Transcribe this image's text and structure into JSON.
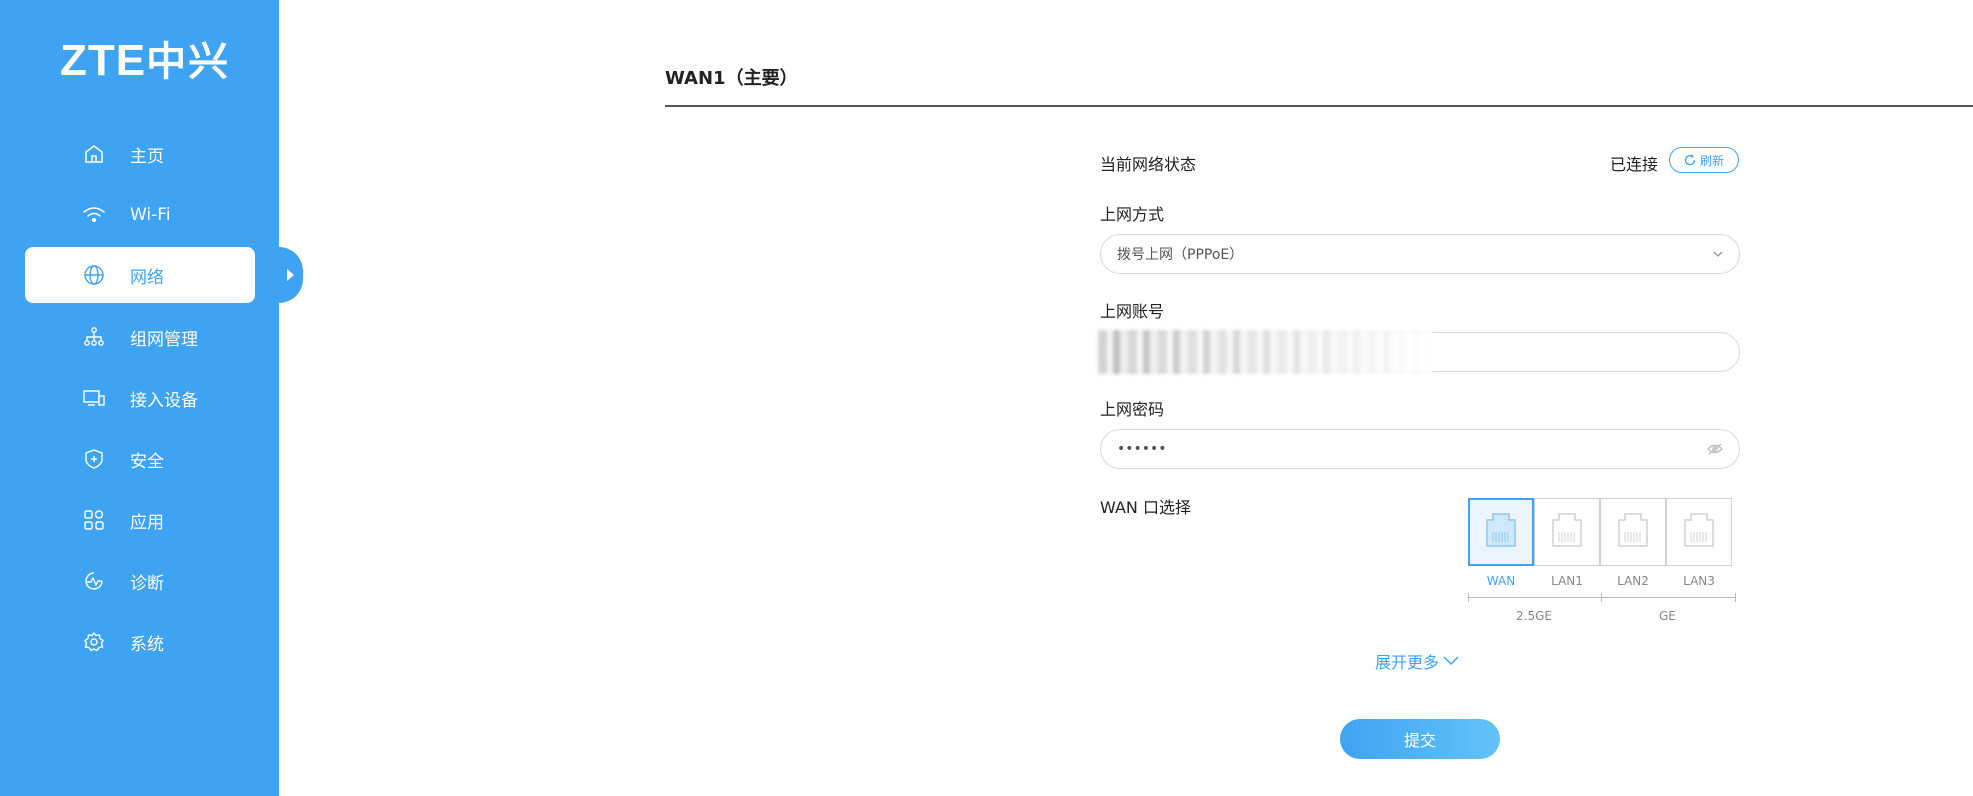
{
  "brand": {
    "logo_latin": "ZTE",
    "logo_cn": "中兴"
  },
  "sidebar": {
    "items": [
      {
        "label": "主页",
        "icon": "home-icon"
      },
      {
        "label": "Wi-Fi",
        "icon": "wifi-icon"
      },
      {
        "label": "网络",
        "icon": "globe-icon",
        "active": true
      },
      {
        "label": "组网管理",
        "icon": "network-topology-icon"
      },
      {
        "label": "接入设备",
        "icon": "devices-icon"
      },
      {
        "label": "安全",
        "icon": "shield-icon"
      },
      {
        "label": "应用",
        "icon": "apps-icon"
      },
      {
        "label": "诊断",
        "icon": "diagnose-icon"
      },
      {
        "label": "系统",
        "icon": "gear-icon"
      }
    ]
  },
  "main": {
    "section_title": "WAN1（主要）",
    "network_status": {
      "label": "当前网络状态",
      "value": "已连接",
      "refresh_label": "刷新"
    },
    "connection_type": {
      "label": "上网方式",
      "value": "拨号上网（PPPoE）"
    },
    "account": {
      "label": "上网账号",
      "value": ""
    },
    "password": {
      "label": "上网密码",
      "value": "••••••"
    },
    "wan_port": {
      "label": "WAN 口选择",
      "ports": [
        "WAN",
        "LAN1",
        "LAN2",
        "LAN3"
      ],
      "selected": "WAN",
      "speeds": [
        "2.5GE",
        "GE"
      ]
    },
    "expand_label": "展开更多",
    "submit_label": "提交"
  },
  "colors": {
    "accent": "#3ea3f3",
    "sidebar_bg": "#3ea3f3"
  }
}
